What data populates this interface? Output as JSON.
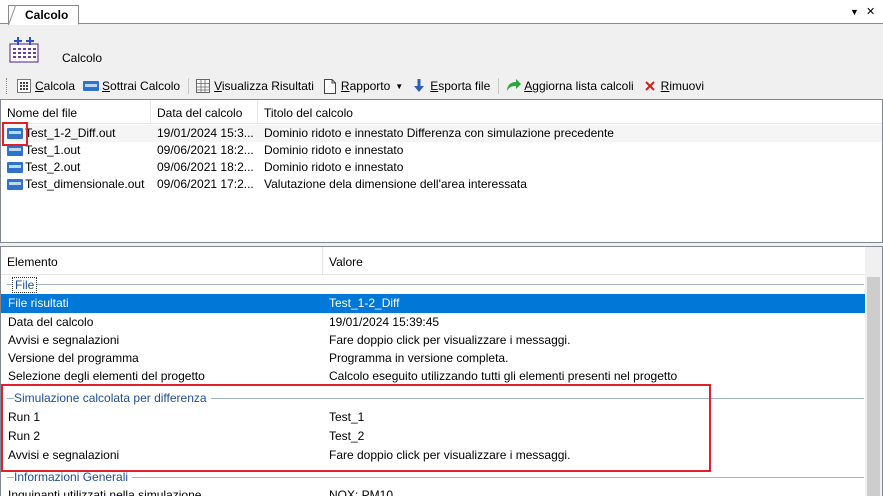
{
  "tab": {
    "label": "Calcolo",
    "dropdown_glyph": "▼",
    "close_glyph": "✕"
  },
  "header": {
    "title": "Calcolo",
    "icon": "calc-grid-icon"
  },
  "toolbar": {
    "calcola": {
      "u": "C",
      "rest": "alcola",
      "icon": "calc-icon"
    },
    "sottrai": {
      "u": "S",
      "rest": "ottrai Calcolo",
      "icon": "subtract-icon"
    },
    "visualizza": {
      "u": "V",
      "rest": "isualizza Risultati",
      "icon": "table-icon"
    },
    "rapporto": {
      "u": "R",
      "rest": "apporto",
      "icon": "document-icon"
    },
    "esporta": {
      "u": "E",
      "rest": "sporta file",
      "icon": "export-arrow-icon"
    },
    "aggiorna": {
      "u": "A",
      "rest": "ggiorna lista calcoli",
      "icon": "refresh-icon"
    },
    "rimuovi": {
      "u": "R",
      "rest": "imuovi",
      "icon": "remove-x-icon"
    }
  },
  "file_list": {
    "columns": [
      "Nome del file",
      "Data del calcolo",
      "Titolo del calcolo"
    ],
    "rows": [
      {
        "name": "Test_1-2_Diff.out",
        "date": "19/01/2024 15:3...",
        "title": "Dominio ridoto e innestato Differenza con simulazione precedente"
      },
      {
        "name": "Test_1.out",
        "date": "09/06/2021 18:2...",
        "title": "Dominio ridoto e innestato"
      },
      {
        "name": "Test_2.out",
        "date": "09/06/2021 18:2...",
        "title": "Dominio ridoto e innestato"
      },
      {
        "name": "Test_dimensionale.out",
        "date": "09/06/2021 17:2...",
        "title": "Valutazione dela dimensione dell'area interessata"
      }
    ]
  },
  "details": {
    "columns": [
      "Elemento",
      "Valore"
    ],
    "group_file": "File",
    "file_rows": [
      {
        "name": "File risultati",
        "value": "Test_1-2_Diff"
      },
      {
        "name": "Data del calcolo",
        "value": "19/01/2024 15:39:45"
      },
      {
        "name": "Avvisi e segnalazioni",
        "value": "Fare doppio click per visualizzare i messaggi."
      },
      {
        "name": "Versione del programma",
        "value": "Programma in versione completa."
      },
      {
        "name": "Selezione degli elementi del progetto",
        "value": "Calcolo eseguito utilizzando tutti gli elementi presenti nel progetto"
      }
    ],
    "group_sim": "Simulazione calcolata per differenza",
    "sim_rows": [
      {
        "name": "Run 1",
        "value": "Test_1"
      },
      {
        "name": "Run 2",
        "value": "Test_2"
      },
      {
        "name": "Avvisi e segnalazioni",
        "value": "Fare doppio click per visualizzare i messaggi."
      }
    ],
    "group_info": "Informazioni Generali",
    "info_rows": [
      {
        "name": "Inquinanti utilizzati nella simulazione",
        "value": "NOX; PM10"
      }
    ]
  },
  "colors": {
    "selection": "#0078d7",
    "highlight": "#e0202a",
    "group_text": "#1f4e96"
  }
}
